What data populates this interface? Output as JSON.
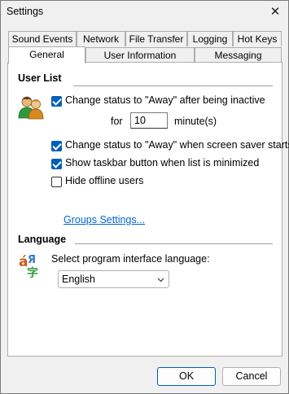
{
  "window": {
    "title": "Settings"
  },
  "tabs": {
    "row1": [
      "Sound Events",
      "Network",
      "File Transfer",
      "Logging",
      "Hot Keys"
    ],
    "row2": [
      "General",
      "User Information",
      "Messaging"
    ],
    "active": "General"
  },
  "user_list": {
    "heading": "User List",
    "away_inactive": {
      "label": "Change status to \"Away\" after being inactive",
      "checked": true
    },
    "for_label": "for",
    "minutes_value": "10",
    "minutes_unit": "minute(s)",
    "away_screensaver": {
      "label": "Change status to \"Away\" when screen saver starts",
      "checked": true
    },
    "taskbar_button": {
      "label": "Show taskbar button when list is minimized",
      "checked": true
    },
    "hide_offline": {
      "label": "Hide offline users",
      "checked": false
    },
    "groups_link": "Groups Settings..."
  },
  "language": {
    "heading": "Language",
    "prompt": "Select program interface language:",
    "selected": "English"
  },
  "buttons": {
    "ok": "OK",
    "cancel": "Cancel"
  },
  "colors": {
    "accent": "#005fb8",
    "link": "#0066cc"
  }
}
